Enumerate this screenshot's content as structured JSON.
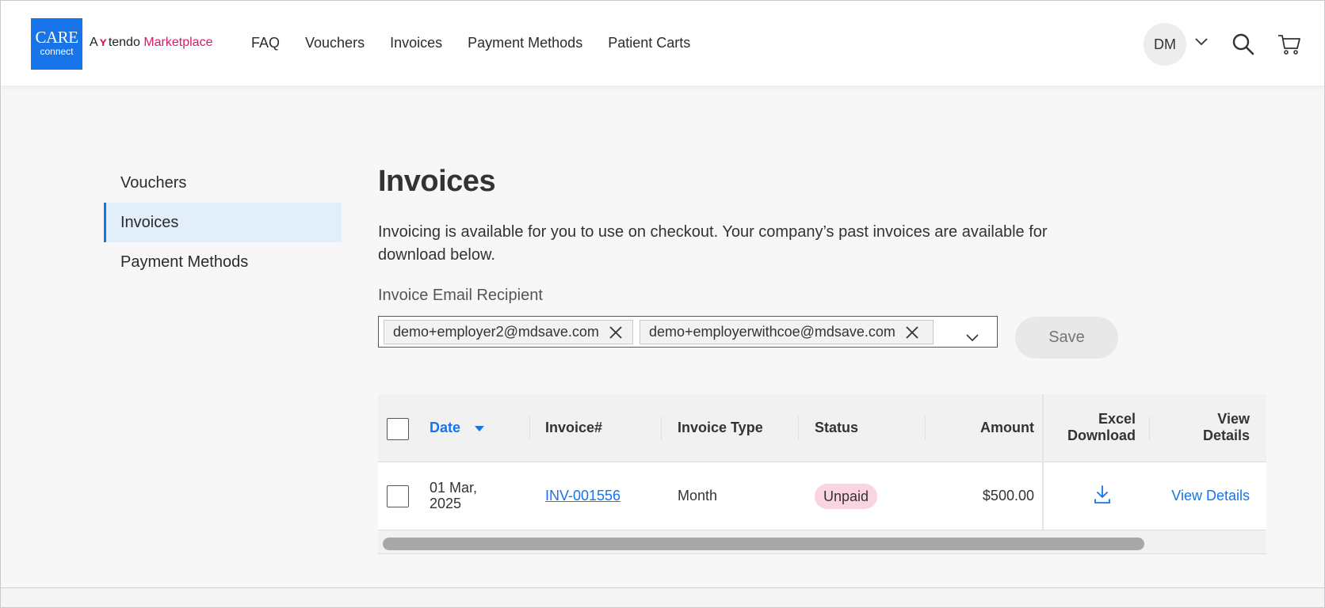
{
  "brand": {
    "logo_line1": "CARE",
    "logo_line2": "connect",
    "a": "A",
    "tendo": "tendo",
    "marketplace": "Marketplace",
    "colors": {
      "primary": "#1874e9",
      "tendo_pink": "#e0166b"
    }
  },
  "topnav": {
    "items": [
      "FAQ",
      "Vouchers",
      "Invoices",
      "Payment Methods",
      "Patient Carts"
    ]
  },
  "user": {
    "initials": "DM"
  },
  "icons": {
    "account_menu": "chevron-down-icon",
    "search": "search-icon",
    "cart": "cart-icon",
    "remove_chip": "close-icon",
    "dropdown": "chevron-down-icon",
    "sort": "sort-desc-icon",
    "download": "download-icon"
  },
  "sidebar": {
    "items": [
      {
        "label": "Vouchers",
        "active": false
      },
      {
        "label": "Invoices",
        "active": true
      },
      {
        "label": "Payment Methods",
        "active": false
      }
    ]
  },
  "main": {
    "title": "Invoices",
    "description": "Invoicing is available for you to use on checkout. Your company’s past invoices are available for download below.",
    "recipient_label": "Invoice Email Recipient",
    "recipients": [
      "demo+employer2@mdsave.com",
      "demo+employerwithcoe@mdsave.com"
    ],
    "save_label": "Save"
  },
  "table": {
    "columns": {
      "date": "Date",
      "invoice": "Invoice#",
      "type": "Invoice Type",
      "status": "Status",
      "amount": "Amount",
      "excel_1": "Excel",
      "excel_2": "Download",
      "view_1": "View",
      "view_2": "Details"
    },
    "rows": [
      {
        "date_1": "01 Mar,",
        "date_2": "2025",
        "invoice": "INV-001556",
        "type": "Month",
        "status": "Unpaid",
        "amount": "$500.00",
        "view": "View Details"
      }
    ],
    "status_colors": {
      "Unpaid": "#fad4df"
    }
  }
}
